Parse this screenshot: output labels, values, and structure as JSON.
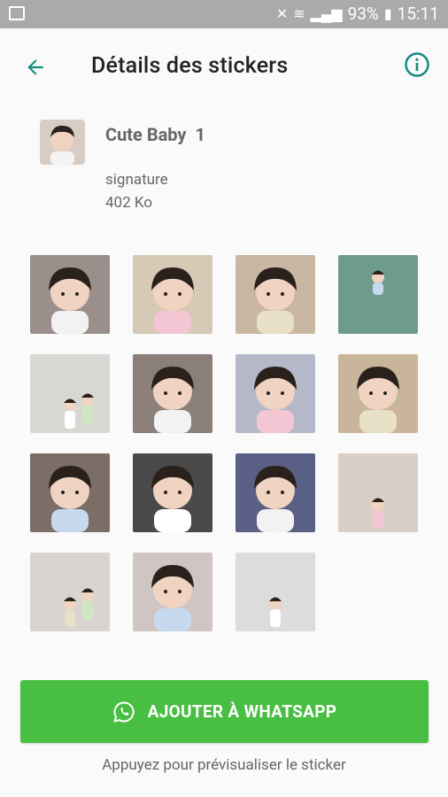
{
  "status_bar": {
    "battery": "93%",
    "time": "15:11"
  },
  "header": {
    "title": "Détails des stickers"
  },
  "pack": {
    "name": "Cute Baby  1",
    "author": "signature",
    "size": "402 Ko"
  },
  "stickers": [
    {
      "bg": "#9a8f8a"
    },
    {
      "bg": "#d6c9b5"
    },
    {
      "bg": "#c9b7a4"
    },
    {
      "bg": "#6d9c8e"
    },
    {
      "bg": "#d9d7d4"
    },
    {
      "bg": "#8a7f79"
    },
    {
      "bg": "#b5b8c8"
    },
    {
      "bg": "#c9b59a"
    },
    {
      "bg": "#7c6e66"
    },
    {
      "bg": "#4a4a4a"
    },
    {
      "bg": "#5a5f86"
    },
    {
      "bg": "#d8cfc6"
    },
    {
      "bg": "#d9d3d2"
    },
    {
      "bg": "#cfc5c3"
    },
    {
      "bg": "#dcdcdc"
    }
  ],
  "actions": {
    "add_label": "AJOUTER À WHATSAPP",
    "hint": "Appuyez pour prévisualiser le sticker"
  },
  "colors": {
    "accent": "#128c7e",
    "button": "#48be43"
  }
}
